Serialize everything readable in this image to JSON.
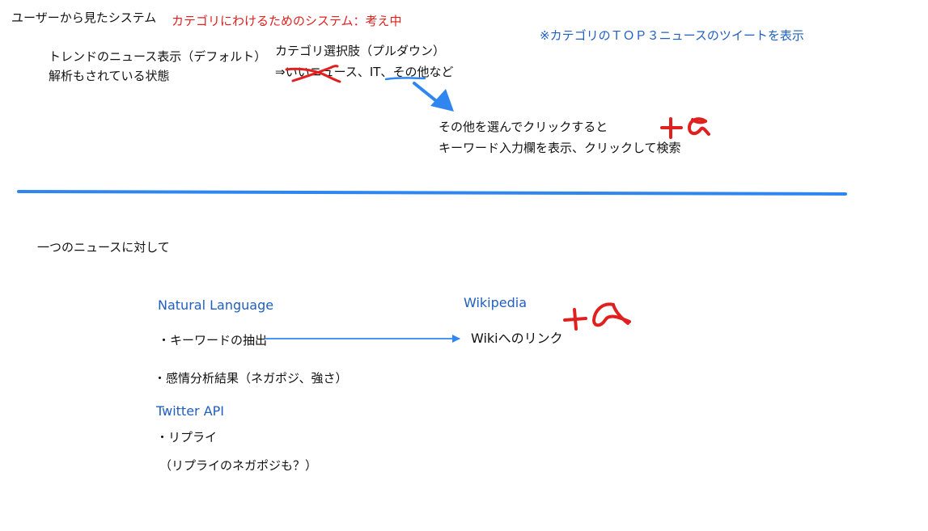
{
  "header": {
    "user_view_title": "ユーザーから見たシステム",
    "category_system_note": "カテゴリにわけるためのシステム：考え中",
    "top3_note": "※カテゴリのＴＯＰ３ニュースのツイートを表示"
  },
  "trend": {
    "line1": "トレンドのニュース表示（デフォルト）",
    "line2": "解析もされている状態"
  },
  "category": {
    "title": "カテゴリ選択肢（プルダウン）",
    "options_prefix": "⇒",
    "options_struck": "いい",
    "options_rest": "ニュース、IT、",
    "options_other": "その他",
    "options_suffix": "など"
  },
  "other_action": {
    "line1": "その他を選んでクリックすると",
    "line2": "キーワード入力欄を表示、クリックして検索"
  },
  "per_news": {
    "title": "一つのニュースに対して"
  },
  "natural_language": {
    "heading": "Natural Language",
    "keyword_extraction": "・キーワードの抽出",
    "sentiment": "・感情分析結果（ネガポジ、強さ）"
  },
  "wikipedia": {
    "heading": "Wikipedia",
    "link": "Wikiへのリンク"
  },
  "twitter": {
    "heading": "Twitter API",
    "reply": "・リプライ",
    "reply_note": "（リプライのネガポジも？）"
  },
  "colors": {
    "red_note": "#e0201e",
    "blue_heading": "#1f5fbf",
    "divider": "#2f86f0",
    "arrow": "#2f86f0"
  }
}
